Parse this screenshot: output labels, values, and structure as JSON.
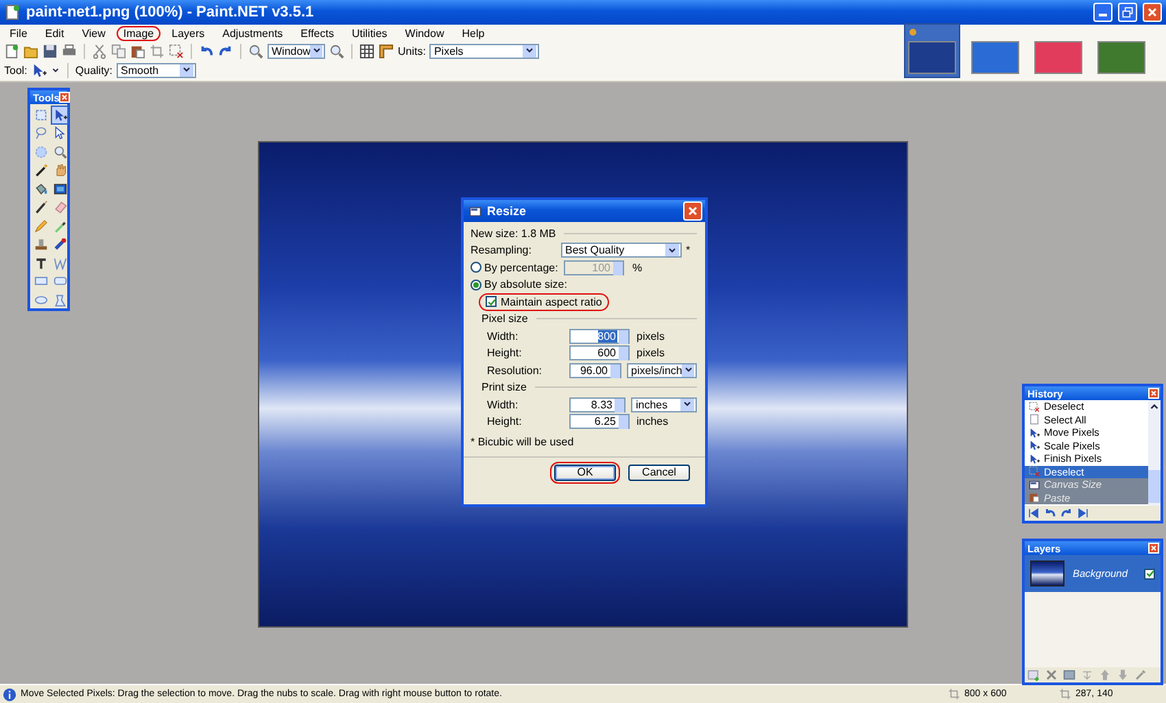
{
  "window": {
    "title": "paint-net1.png (100%) - Paint.NET v3.5.1"
  },
  "menu": [
    {
      "label": "File",
      "annotated": false
    },
    {
      "label": "Edit",
      "annotated": false
    },
    {
      "label": "View",
      "annotated": false
    },
    {
      "label": "Image",
      "annotated": true
    },
    {
      "label": "Layers",
      "annotated": false
    },
    {
      "label": "Adjustments",
      "annotated": false
    },
    {
      "label": "Effects",
      "annotated": false
    },
    {
      "label": "Utilities",
      "annotated": false
    },
    {
      "label": "Window",
      "annotated": false
    },
    {
      "label": "Help",
      "annotated": false
    }
  ],
  "toolbar": {
    "zoom": "Window",
    "units_label": "Units:",
    "units": "Pixels",
    "tool_label": "Tool:",
    "quality_label": "Quality:",
    "quality": "Smooth"
  },
  "thumbnails": [
    {
      "selected": true,
      "modified": true,
      "color": "#1d3c8c"
    },
    {
      "selected": false,
      "modified": false,
      "color": "#2a6bd6"
    },
    {
      "selected": false,
      "modified": false,
      "color": "#e23c5c"
    },
    {
      "selected": false,
      "modified": false,
      "color": "#3f7a2e"
    }
  ],
  "tools": {
    "title": "Tools",
    "items": [
      {
        "kind": "rect-select",
        "selected": false
      },
      {
        "kind": "move-pixels",
        "selected": true
      },
      {
        "kind": "lasso",
        "selected": false
      },
      {
        "kind": "move-selection",
        "selected": false
      },
      {
        "kind": "ellipse-select",
        "selected": false
      },
      {
        "kind": "zoom",
        "selected": false
      },
      {
        "kind": "magic-wand",
        "selected": false
      },
      {
        "kind": "pan",
        "selected": false
      },
      {
        "kind": "bucket",
        "selected": false
      },
      {
        "kind": "gradient",
        "selected": false
      },
      {
        "kind": "brush",
        "selected": false
      },
      {
        "kind": "eraser",
        "selected": false
      },
      {
        "kind": "pencil",
        "selected": false
      },
      {
        "kind": "picker",
        "selected": false
      },
      {
        "kind": "stamp",
        "selected": false
      },
      {
        "kind": "recolor",
        "selected": false
      },
      {
        "kind": "text",
        "selected": false
      },
      {
        "kind": "line",
        "selected": false
      },
      {
        "kind": "rectangle",
        "selected": false
      },
      {
        "kind": "rounded-rectangle",
        "selected": false
      },
      {
        "kind": "ellipse",
        "selected": false
      },
      {
        "kind": "freeform",
        "selected": false
      }
    ]
  },
  "resize_dialog": {
    "title": "Resize",
    "new_size": "New size: 1.8 MB",
    "resampling_label": "Resampling:",
    "resampling": "Best Quality",
    "resampling_note": "*",
    "modes": [
      {
        "label": "By percentage:",
        "selected": false
      },
      {
        "label": "By absolute size:",
        "selected": true
      }
    ],
    "percentage": "100",
    "percent_sign": "%",
    "maintain_aspect": {
      "label": "Maintain aspect ratio",
      "checked": true,
      "annotated": true
    },
    "pixel_size": {
      "title": "Pixel size",
      "fields": [
        {
          "label": "Width:",
          "value": "800",
          "text_selected": true,
          "unit": "pixels",
          "kind": "text"
        },
        {
          "label": "Height:",
          "value": "600",
          "text_selected": false,
          "unit": "pixels",
          "kind": "text"
        },
        {
          "label": "Resolution:",
          "value": "96.00",
          "text_selected": false,
          "unit": "pixels/inch",
          "kind": "dropdown"
        }
      ]
    },
    "print_size": {
      "title": "Print size",
      "fields": [
        {
          "label": "Width:",
          "value": "8.33",
          "text_selected": false,
          "unit": "inches",
          "kind": "dropdown"
        },
        {
          "label": "Height:",
          "value": "6.25",
          "text_selected": false,
          "unit": "inches",
          "kind": "text"
        }
      ]
    },
    "footnote": "* Bicubic will be used",
    "buttons": [
      {
        "label": "OK",
        "annotated": true,
        "default": true
      },
      {
        "label": "Cancel",
        "annotated": false,
        "default": false
      }
    ]
  },
  "history": {
    "title": "History",
    "items": [
      {
        "label": "Deselect",
        "kind": "deselect",
        "selected": false,
        "undone": false
      },
      {
        "label": "Select All",
        "kind": "select-all",
        "selected": false,
        "undone": false
      },
      {
        "label": "Move Pixels",
        "kind": "move",
        "selected": false,
        "undone": false
      },
      {
        "label": "Scale Pixels",
        "kind": "move",
        "selected": false,
        "undone": false
      },
      {
        "label": "Finish Pixels",
        "kind": "move",
        "selected": false,
        "undone": false
      },
      {
        "label": "Deselect",
        "kind": "deselect",
        "selected": true,
        "undone": false
      },
      {
        "label": "Canvas Size",
        "kind": "canvas-size",
        "selected": false,
        "undone": true
      },
      {
        "label": "Paste",
        "kind": "paste",
        "selected": false,
        "undone": true
      }
    ]
  },
  "layers": {
    "title": "Layers",
    "items": [
      {
        "name": "Background",
        "selected": true,
        "visible": true
      }
    ]
  },
  "status_bar": {
    "message": "Move Selected Pixels: Drag the selection to move. Drag the nubs to scale. Drag with right mouse button to rotate.",
    "size": "800 x 600",
    "position": "287, 140"
  }
}
